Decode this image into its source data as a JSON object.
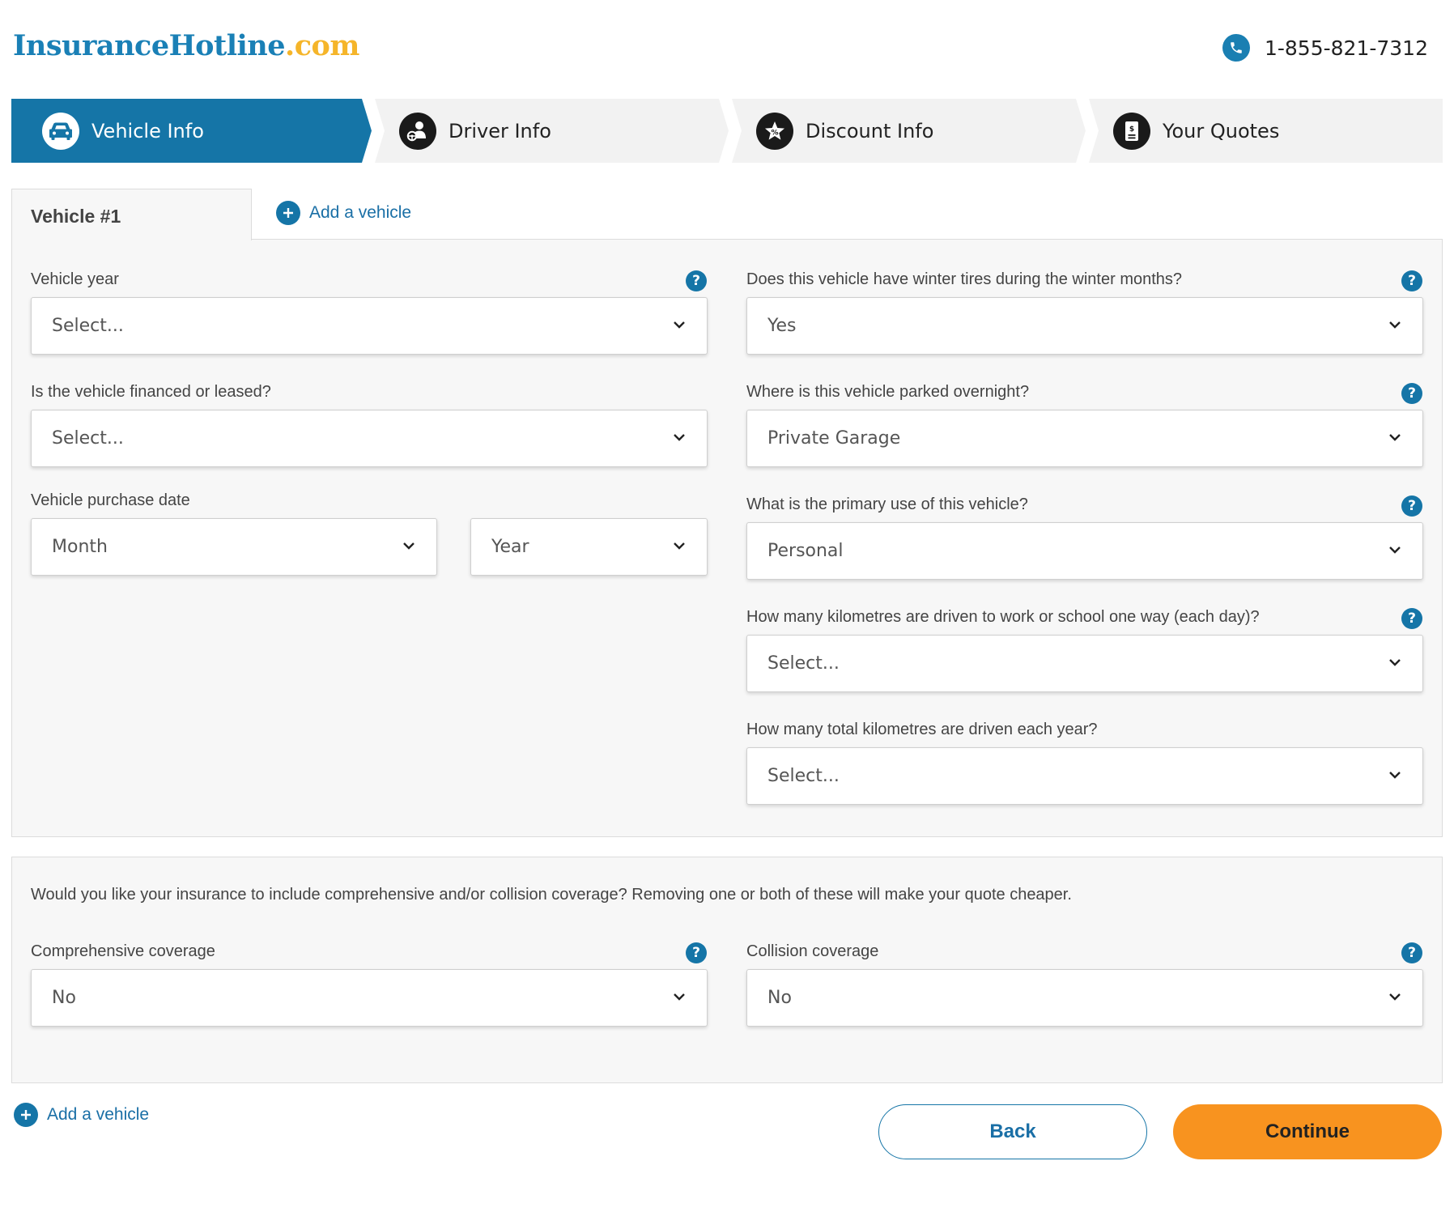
{
  "header": {
    "logo_brand": "InsuranceHotline",
    "logo_tld": ".com",
    "phone": "1-855-821-7312"
  },
  "steps": [
    {
      "label": "Vehicle Info",
      "icon": "car-icon",
      "active": true
    },
    {
      "label": "Driver Info",
      "icon": "driver-icon",
      "active": false
    },
    {
      "label": "Discount Info",
      "icon": "star-badge-icon",
      "active": false
    },
    {
      "label": "Your Quotes",
      "icon": "quote-document-icon",
      "active": false
    }
  ],
  "tabs": {
    "active_label": "Vehicle #1",
    "add_vehicle": "Add a vehicle"
  },
  "vehicle": {
    "year": {
      "label": "Vehicle year",
      "value": "Select..."
    },
    "financed": {
      "label": "Is the vehicle financed or leased?",
      "value": "Select..."
    },
    "purchase": {
      "label": "Vehicle purchase date",
      "month": "Month",
      "year": "Year"
    },
    "winter_tires": {
      "label": "Does this vehicle have winter tires during the winter months?",
      "value": "Yes"
    },
    "parked": {
      "label": "Where is this vehicle parked overnight?",
      "value": "Private Garage"
    },
    "primary_use": {
      "label": "What is the primary use of this vehicle?",
      "value": "Personal"
    },
    "km_commute": {
      "label": "How many kilometres are driven to work or school one way (each day)?",
      "value": "Select..."
    },
    "km_year": {
      "label": "How many total kilometres are driven each year?",
      "value": "Select..."
    }
  },
  "coverage": {
    "question": "Would you like your insurance to include comprehensive and/or collision coverage? Removing one or both of these will make your quote cheaper.",
    "comprehensive": {
      "label": "Comprehensive coverage",
      "value": "No"
    },
    "collision": {
      "label": "Collision coverage",
      "value": "No"
    }
  },
  "help_glyph": "?",
  "footer": {
    "add_vehicle": "Add a vehicle",
    "back": "Back",
    "continue": "Continue"
  },
  "colors": {
    "primary_blue": "#1575a7",
    "logo_blue": "#1a80b6",
    "logo_gold": "#f5b52a",
    "continue_orange": "#f8931f"
  }
}
